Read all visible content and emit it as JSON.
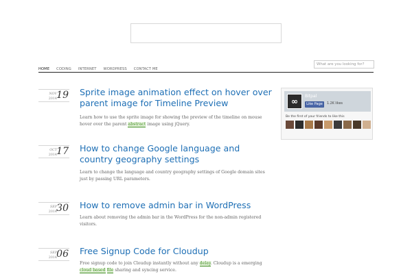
{
  "header": {
    "search_placeholder": "What are you looking for?"
  },
  "nav": {
    "items": [
      {
        "label": "HOME",
        "active": true
      },
      {
        "label": "CODING",
        "active": false
      },
      {
        "label": "INTERNET",
        "active": false
      },
      {
        "label": "WORDPRESS",
        "active": false
      },
      {
        "label": "CONTACT ME",
        "active": false
      }
    ]
  },
  "posts": [
    {
      "month": "NOV",
      "day": "19",
      "year": "2014",
      "title": "Sprite image animation effect on hover over parent image for Timeline Preview",
      "excerpt_before": "Learn how to use the sprite image for showing the preview of the timeline on mouse hover over the parent ",
      "excerpt_link": "abstract",
      "excerpt_after": " image using jQuery."
    },
    {
      "month": "OCT",
      "day": "17",
      "year": "2014",
      "title": "How to change Google language and country geography settings",
      "excerpt": "Learn to change the language and country geography settings of Google domain sites just by passing URL parameters."
    },
    {
      "month": "SEP",
      "day": "30",
      "year": "2014",
      "title": "How to remove admin bar in WordPress",
      "excerpt": "Learn about removing the admin bar in the WordPress for the non-admin registered visitors."
    },
    {
      "month": "SEP",
      "day": "06",
      "year": "2014",
      "title": "Free Signup Code for Cloudup",
      "excerpt_p1": "Free signup code to join Cloudup instantly without any ",
      "excerpt_link1": "delay",
      "excerpt_p2": ". Cloudup is a emerging ",
      "excerpt_link2": "cloud based",
      "excerpt_p3": " ",
      "excerpt_link3": "file",
      "excerpt_p4": " sharing and syncing service."
    }
  ],
  "widget": {
    "page_name": "Bitpal",
    "logo_glyph": "∞",
    "like_label": "Like Page",
    "count_text": "1.2K likes",
    "friends_text": "Be the first of your friends to like this",
    "face_colors": [
      "#6b4a3a",
      "#2d2d2d",
      "#a87a4a",
      "#5c3b2a",
      "#c89a6a",
      "#3b3b3b",
      "#8a6a4a",
      "#4a3a2a",
      "#d0b090"
    ]
  }
}
